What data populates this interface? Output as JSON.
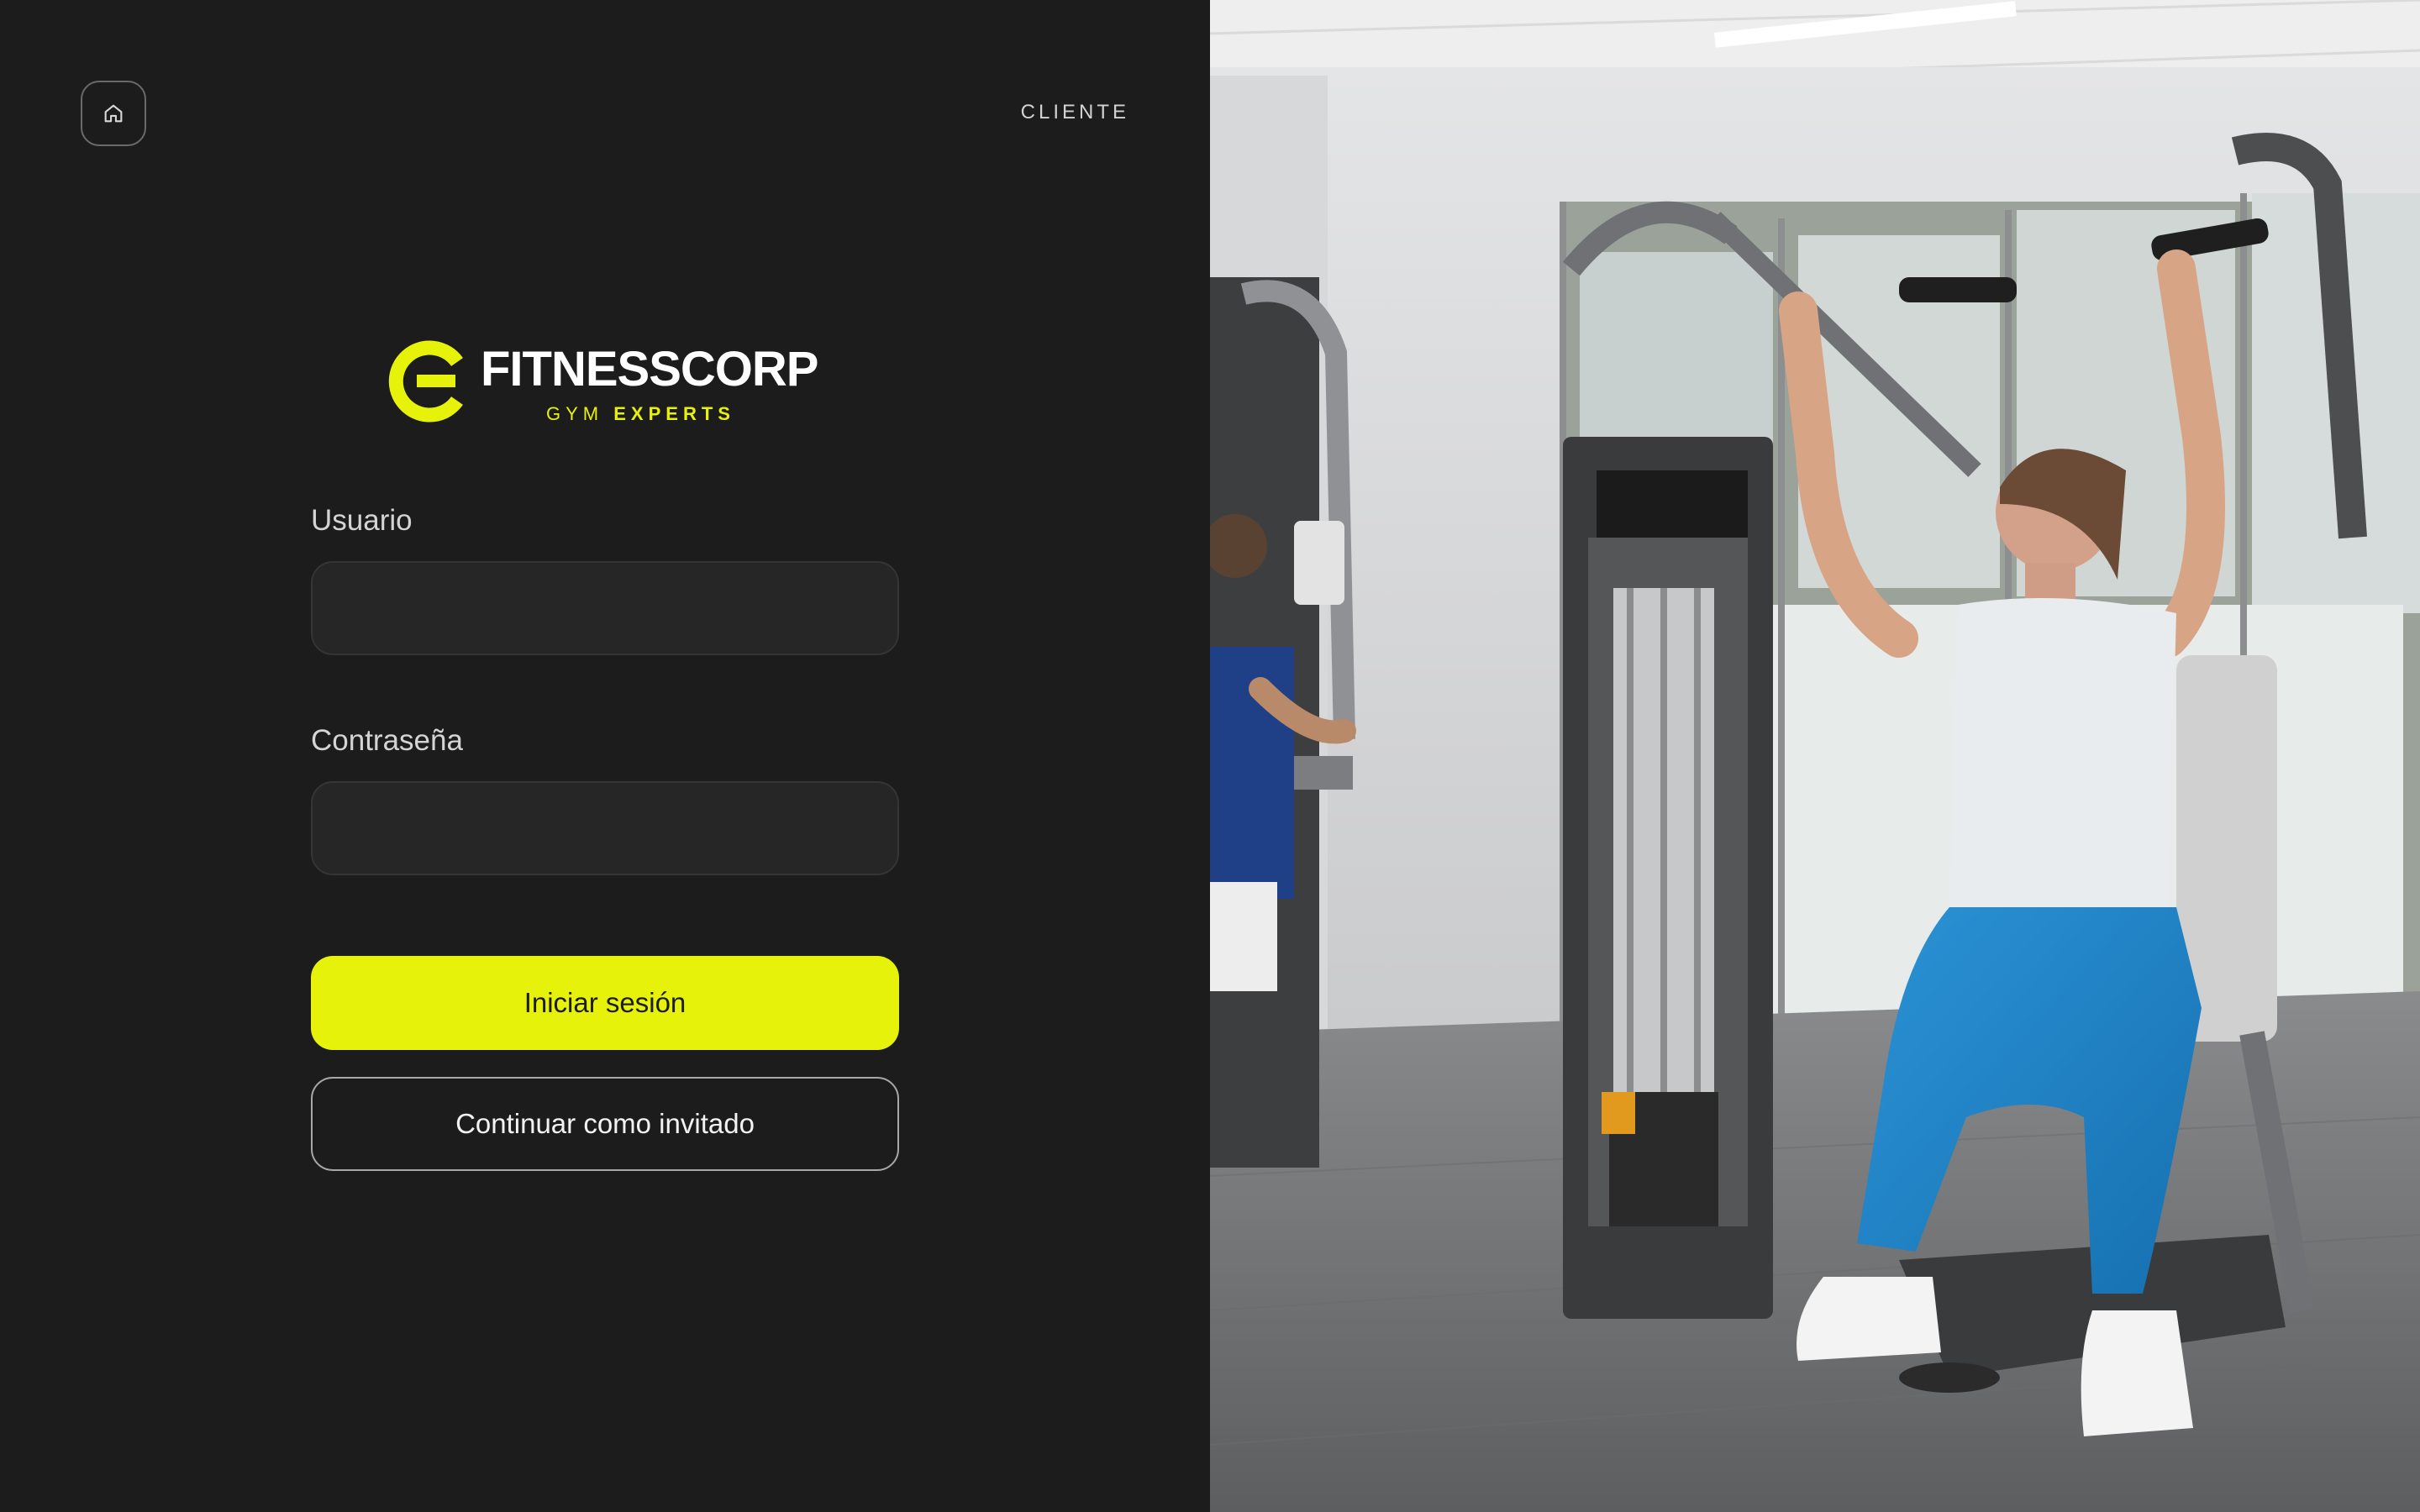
{
  "header": {
    "role_label": "CLIENTE",
    "home_icon": "home-icon"
  },
  "brand": {
    "name": "FITNESSCORP",
    "tagline_light": "GYM",
    "tagline_bold": "EXPERTS",
    "accent_color": "#e6f20a",
    "logo_icon": "fitnesscorp-logo-mark"
  },
  "form": {
    "username_label": "Usuario",
    "username_value": "",
    "password_label": "Contraseña",
    "password_value": "",
    "login_button": "Iniciar sesión",
    "guest_button": "Continuar como invitado"
  },
  "colors": {
    "panel_background": "#1c1c1c",
    "primary_button": "#e6f20a",
    "field_background": "#262626"
  }
}
